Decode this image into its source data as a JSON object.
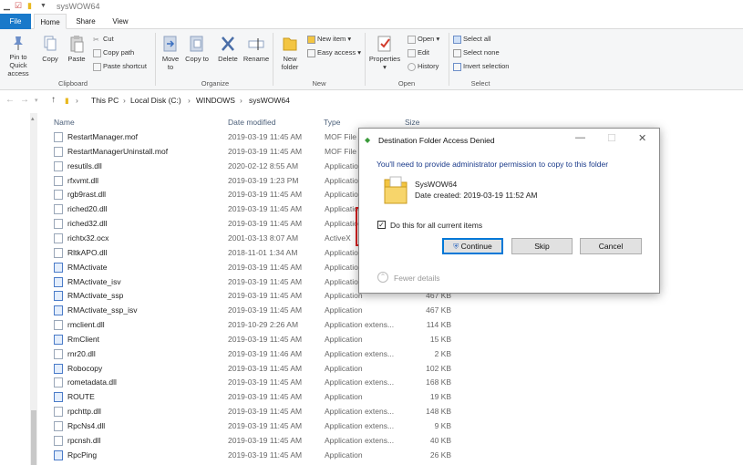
{
  "window": {
    "title": "sysWOW64"
  },
  "tabs": [
    {
      "label": "File"
    },
    {
      "label": "Home"
    },
    {
      "label": "Share"
    },
    {
      "label": "View"
    }
  ],
  "ribbon": {
    "clipboard": {
      "pin_label": "Pin to Quick access",
      "copy_label": "Copy",
      "paste_label": "Paste",
      "cut_label": "Cut",
      "copy_path_label": "Copy path",
      "paste_shortcut_label": "Paste shortcut",
      "group_label": "Clipboard"
    },
    "organize": {
      "move_label": "Move to",
      "copy_to_label": "Copy to",
      "delete_label": "Delete",
      "rename_label": "Rename",
      "group_label": "Organize"
    },
    "new": {
      "new_folder_label": "New folder",
      "new_item_label": "New item",
      "easy_access_label": "Easy access",
      "group_label": "New"
    },
    "open": {
      "properties_label": "Properties",
      "open_label": "Open",
      "edit_label": "Edit",
      "history_label": "History",
      "group_label": "Open"
    },
    "select": {
      "select_all_label": "Select all",
      "select_none_label": "Select none",
      "invert_label": "Invert selection",
      "group_label": "Select"
    }
  },
  "address": {
    "crumbs": [
      "This PC",
      "Local Disk (C:)",
      "WINDOWS",
      "sysWOW64"
    ]
  },
  "columns": {
    "name": "Name",
    "date": "Date modified",
    "type": "Type",
    "size": "Size"
  },
  "files": [
    {
      "name": "RestartManager.mof",
      "date": "2019-03-19 11:45 AM",
      "type": "MOF File",
      "size": "",
      "kind": "doc"
    },
    {
      "name": "RestartManagerUninstall.mof",
      "date": "2019-03-19 11:45 AM",
      "type": "MOF File",
      "size": "",
      "kind": "doc"
    },
    {
      "name": "resutils.dll",
      "date": "2020-02-12 8:55 AM",
      "type": "Application",
      "size": "",
      "kind": "doc"
    },
    {
      "name": "rfxvmt.dll",
      "date": "2019-03-19 1:23 PM",
      "type": "Application",
      "size": "",
      "kind": "doc"
    },
    {
      "name": "rgb9rast.dll",
      "date": "2019-03-19 11:45 AM",
      "type": "Application",
      "size": "",
      "kind": "doc"
    },
    {
      "name": "riched20.dll",
      "date": "2019-03-19 11:45 AM",
      "type": "Application",
      "size": "",
      "kind": "doc"
    },
    {
      "name": "riched32.dll",
      "date": "2019-03-19 11:45 AM",
      "type": "Application",
      "size": "",
      "kind": "doc"
    },
    {
      "name": "richtx32.ocx",
      "date": "2001-03-13 8:07 AM",
      "type": "ActiveX",
      "size": "",
      "kind": "doc"
    },
    {
      "name": "RltkAPO.dll",
      "date": "2018-11-01 1:34 AM",
      "type": "Application",
      "size": "",
      "kind": "doc"
    },
    {
      "name": "RMActivate",
      "date": "2019-03-19 11:45 AM",
      "type": "Application",
      "size": "",
      "kind": "exe"
    },
    {
      "name": "RMActivate_isv",
      "date": "2019-03-19 11:45 AM",
      "type": "Application",
      "size": "",
      "kind": "exe"
    },
    {
      "name": "RMActivate_ssp",
      "date": "2019-03-19 11:45 AM",
      "type": "Application",
      "size": "467 KB",
      "kind": "exe"
    },
    {
      "name": "RMActivate_ssp_isv",
      "date": "2019-03-19 11:45 AM",
      "type": "Application",
      "size": "467 KB",
      "kind": "exe"
    },
    {
      "name": "rmclient.dll",
      "date": "2019-10-29 2:26 AM",
      "type": "Application extens...",
      "size": "114 KB",
      "kind": "doc"
    },
    {
      "name": "RmClient",
      "date": "2019-03-19 11:45 AM",
      "type": "Application",
      "size": "15 KB",
      "kind": "exe"
    },
    {
      "name": "rnr20.dll",
      "date": "2019-03-19 11:46 AM",
      "type": "Application extens...",
      "size": "2 KB",
      "kind": "doc"
    },
    {
      "name": "Robocopy",
      "date": "2019-03-19 11:45 AM",
      "type": "Application",
      "size": "102 KB",
      "kind": "exe"
    },
    {
      "name": "rometadata.dll",
      "date": "2019-03-19 11:45 AM",
      "type": "Application extens...",
      "size": "168 KB",
      "kind": "doc"
    },
    {
      "name": "ROUTE",
      "date": "2019-03-19 11:45 AM",
      "type": "Application",
      "size": "19 KB",
      "kind": "exe"
    },
    {
      "name": "rpchttp.dll",
      "date": "2019-03-19 11:45 AM",
      "type": "Application extens...",
      "size": "148 KB",
      "kind": "doc"
    },
    {
      "name": "RpcNs4.dll",
      "date": "2019-03-19 11:45 AM",
      "type": "Application extens...",
      "size": "9 KB",
      "kind": "doc"
    },
    {
      "name": "rpcnsh.dll",
      "date": "2019-03-19 11:45 AM",
      "type": "Application extens...",
      "size": "40 KB",
      "kind": "doc"
    },
    {
      "name": "RpcPing",
      "date": "2019-03-19 11:45 AM",
      "type": "Application",
      "size": "26 KB",
      "kind": "exe"
    }
  ],
  "dialog": {
    "title": "Destination Folder Access Denied",
    "message": "You'll need to provide administrator permission to copy to this folder",
    "folder_name": "SysWOW64",
    "date_created": "Date created: 2019-03-19 11:52 AM",
    "checkbox_label": "Do this for all current items",
    "continue_label": "Continue",
    "skip_label": "Skip",
    "cancel_label": "Cancel",
    "fewer_details_label": "Fewer details",
    "close_glyph": "✕"
  }
}
